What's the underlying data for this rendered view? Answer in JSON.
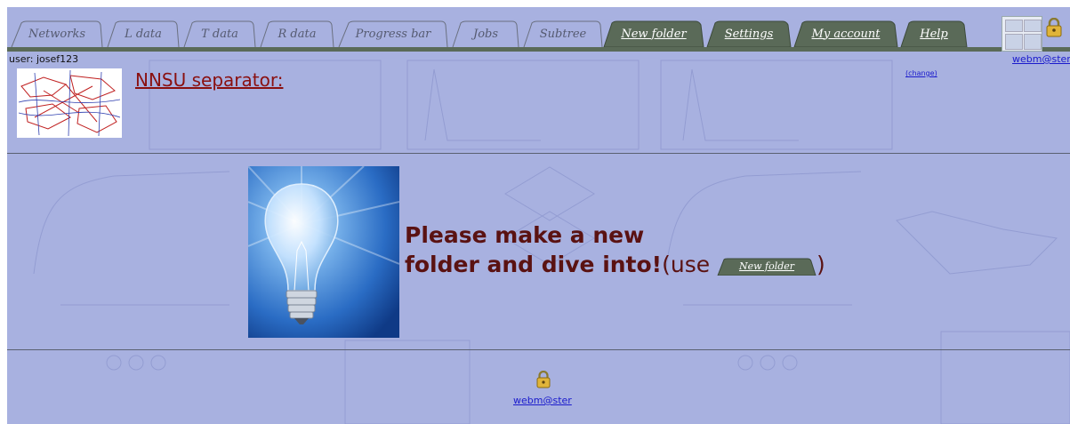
{
  "tabs": [
    {
      "label": "Networks",
      "style": "light"
    },
    {
      "label": "L data",
      "style": "light"
    },
    {
      "label": "T data",
      "style": "light"
    },
    {
      "label": "R data",
      "style": "light"
    },
    {
      "label": "Progress bar",
      "style": "light"
    },
    {
      "label": "Jobs",
      "style": "light"
    },
    {
      "label": "Subtree",
      "style": "light"
    },
    {
      "label": "New folder",
      "style": "dark"
    },
    {
      "label": "Settings",
      "style": "dark"
    },
    {
      "label": "My account",
      "style": "dark"
    },
    {
      "label": "Help",
      "style": "dark"
    }
  ],
  "header": {
    "user_label": "user: josef123",
    "webmaster_link": "webm@ster",
    "change_link": "(change)"
  },
  "project": {
    "title": "NNSU separator:"
  },
  "message": {
    "line1": "Please make a new",
    "line2": "folder and dive into!",
    "use_prefix": "(use ",
    "button_label": "New folder",
    "use_suffix": ")"
  },
  "footer": {
    "webmaster_link": "webm@ster"
  },
  "colors": {
    "background": "#a8b1e0",
    "light_tab": "#a8b1e0",
    "dark_tab": "#5a6a58",
    "title_red": "#8a1010",
    "message_brown": "#5a1212",
    "link_blue": "#1a1acc"
  },
  "icons": {
    "lock": "lock-icon",
    "logo": "site-logo",
    "bulb": "light-bulb-image",
    "thumbnail": "network-thumbnail"
  }
}
